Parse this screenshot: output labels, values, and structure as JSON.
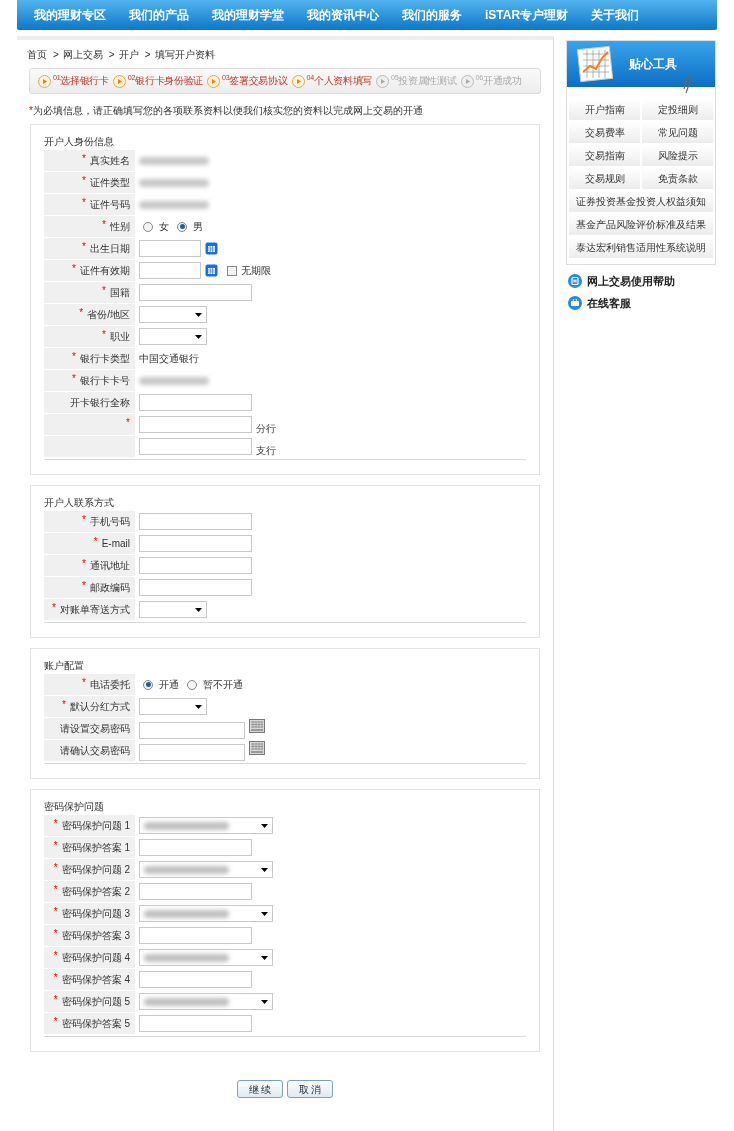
{
  "nav": [
    "我的理财专区",
    "我们的产品",
    "我的理财学堂",
    "我的资讯中心",
    "我们的服务",
    "iSTAR专户理财",
    "关于我们"
  ],
  "breadcrumb": {
    "separator": ">",
    "items": [
      "首页",
      "网上交易",
      "开户",
      "填写开户资料"
    ]
  },
  "steps": [
    {
      "label": "$^{01}$选择银行卡",
      "done": true
    },
    {
      "label": "$^{02}$银行卡身份验证",
      "done": true
    },
    {
      "label": "$^{03}$签署交易协议",
      "done": true
    },
    {
      "label": "$^{04}$个人资料填写",
      "done": true
    },
    {
      "label": "$^{05}$投资属性测试",
      "done": false
    },
    {
      "label": "$^{06}$开通成功",
      "done": false
    }
  ],
  "notice": {
    "mark": "*",
    "text": "为必填信息，请正确填写您的各项联系资料以便我们核实您的资料以完成网上交易的开通"
  },
  "sections": [
    {
      "title": "开户人身份信息",
      "rows": [
        {
          "label": "真实姓名",
          "required": true,
          "kind": "blurred"
        },
        {
          "label": "证件类型",
          "required": true,
          "kind": "blurred"
        },
        {
          "label": "证件号码",
          "required": true,
          "kind": "blurred"
        },
        {
          "label": "性别",
          "required": true,
          "kind": "radio",
          "options": [
            {
              "label": "女",
              "selected": false
            },
            {
              "label": "男",
              "selected": true
            }
          ]
        },
        {
          "label": "出生日期",
          "required": true,
          "kind": "date"
        },
        {
          "label": "证件有效期",
          "required": true,
          "kind": "date",
          "checkbox": {
            "label": "无期限",
            "checked": false
          }
        },
        {
          "label": "国籍",
          "required": true,
          "kind": "text"
        },
        {
          "label": "省份/地区",
          "required": true,
          "kind": "select"
        },
        {
          "label": "职业",
          "required": true,
          "kind": "select"
        },
        {
          "label": "银行卡类型",
          "required": true,
          "kind": "static",
          "value": "中国交通银行"
        },
        {
          "label": "银行卡卡号",
          "required": true,
          "kind": "blurred"
        },
        {
          "label": "开卡银行全称",
          "required": false,
          "kind": "text"
        },
        {
          "required": true,
          "kind": "text",
          "suffix": "分行"
        },
        {
          "required": false,
          "kind": "text",
          "suffix": "支行"
        }
      ]
    },
    {
      "title": "开户人联系方式",
      "rows": [
        {
          "label": "手机号码",
          "required": true,
          "kind": "text"
        },
        {
          "label": "E-mail",
          "required": true,
          "kind": "text"
        },
        {
          "label": "通讯地址",
          "required": true,
          "kind": "text"
        },
        {
          "label": "邮政编码",
          "required": true,
          "kind": "text"
        },
        {
          "label": "对账单寄送方式",
          "required": true,
          "kind": "select"
        }
      ]
    },
    {
      "title": "账户配置",
      "rows": [
        {
          "label": "电话委托",
          "required": true,
          "kind": "radio",
          "options": [
            {
              "label": "开通",
              "selected": true
            },
            {
              "label": "暂不开通",
              "selected": false
            }
          ]
        },
        {
          "label": "默认分红方式",
          "required": true,
          "kind": "select"
        },
        {
          "label": "请设置交易密码",
          "required": false,
          "kind": "password"
        },
        {
          "label": "请确认交易密码",
          "required": false,
          "kind": "password"
        }
      ]
    },
    {
      "title": "密码保护问题",
      "rows": [
        {
          "label": "密码保护问题 1",
          "required": true,
          "kind": "question"
        },
        {
          "label": "密码保护答案 1",
          "required": true,
          "kind": "text"
        },
        {
          "label": "密码保护问题 2",
          "required": true,
          "kind": "question"
        },
        {
          "label": "密码保护答案 2",
          "required": true,
          "kind": "text"
        },
        {
          "label": "密码保护问题 3",
          "required": true,
          "kind": "question"
        },
        {
          "label": "密码保护答案 3",
          "required": true,
          "kind": "text"
        },
        {
          "label": "密码保护问题 4",
          "required": true,
          "kind": "question"
        },
        {
          "label": "密码保护答案 4",
          "required": true,
          "kind": "text"
        },
        {
          "label": "密码保护问题 5",
          "required": true,
          "kind": "question"
        },
        {
          "label": "密码保护答案 5",
          "required": true,
          "kind": "text"
        }
      ]
    }
  ],
  "buttons": [
    "继 续",
    "取 消"
  ],
  "sidebar": {
    "title": "贴心工具",
    "links": [
      {
        "label": "开户指南",
        "wide": false
      },
      {
        "label": "定投细则",
        "wide": false
      },
      {
        "label": "交易费率",
        "wide": false
      },
      {
        "label": "常见问题",
        "wide": false
      },
      {
        "label": "交易指南",
        "wide": false
      },
      {
        "label": "风险提示",
        "wide": false
      },
      {
        "label": "交易规则",
        "wide": false
      },
      {
        "label": "免责条款",
        "wide": false
      },
      {
        "label": "证券投资基金投资人权益须知",
        "wide": true
      },
      {
        "label": "基金产品风险评价标准及结果",
        "wide": true
      },
      {
        "label": "泰达宏利销售适用性系统说明",
        "wide": true
      }
    ],
    "help": [
      {
        "label": "网上交易使用帮助",
        "kind": "help"
      },
      {
        "label": "在线客服",
        "kind": "service"
      }
    ]
  }
}
